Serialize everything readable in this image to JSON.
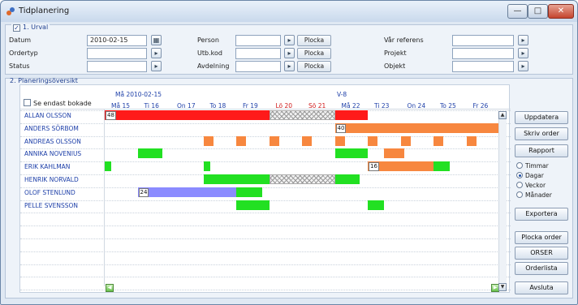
{
  "window": {
    "title": "Tidplanering",
    "controls": {
      "minimize": "—",
      "maximize": "□",
      "close": "✕"
    }
  },
  "filter": {
    "section_title": "1. Urval",
    "checked": true,
    "fields": [
      {
        "label": "Datum",
        "value": "2010-02-15"
      },
      {
        "label": "Ordertyp",
        "value": ""
      },
      {
        "label": "Status",
        "value": ""
      },
      {
        "label": "Person",
        "value": ""
      },
      {
        "label": "Utb.kod",
        "value": ""
      },
      {
        "label": "Avdelning",
        "value": ""
      },
      {
        "label": "Vår referens",
        "value": ""
      },
      {
        "label": "Projekt",
        "value": ""
      },
      {
        "label": "Objekt",
        "value": ""
      }
    ],
    "plocka_label": "Plocka",
    "check_mark": "✓"
  },
  "planning": {
    "section_title": "2. Planeringsöversikt",
    "only_booked_label": "Se endast bokade",
    "week_labels": [
      "Må 2010-02-15",
      "V-8"
    ],
    "days": [
      "Må 15",
      "Ti 16",
      "On 17",
      "To 18",
      "Fr 19",
      "Lö 20",
      "Sö 21",
      "Må 22",
      "Ti 23",
      "On 24",
      "To 25",
      "Fr 26"
    ],
    "weekend_color": "#d11a1a",
    "people": [
      {
        "name": "ALLAN OLSSON",
        "bars": [
          {
            "start": 0,
            "days": 5,
            "color": "#ff1a1a",
            "label": "48"
          },
          {
            "start": 5,
            "days": 2,
            "style": "hatched"
          },
          {
            "start": 7,
            "days": 1,
            "color": "#ff1a1a"
          }
        ]
      },
      {
        "name": "ANDERS SÖRBOM",
        "bars": [
          {
            "start": 7,
            "days": 5,
            "color": "#f7873f",
            "label": "40"
          }
        ]
      },
      {
        "name": "ANDREAS OLSSON",
        "bars": [
          {
            "start": 3,
            "days": 0.3,
            "color": "#f7873f"
          },
          {
            "start": 4,
            "days": 0.3,
            "color": "#f7873f"
          },
          {
            "start": 5,
            "days": 0.3,
            "color": "#f7873f"
          },
          {
            "start": 6,
            "days": 0.3,
            "color": "#f7873f"
          },
          {
            "start": 7,
            "days": 0.3,
            "color": "#f7873f"
          },
          {
            "start": 8,
            "days": 0.3,
            "color": "#f7873f"
          },
          {
            "start": 9,
            "days": 0.3,
            "color": "#f7873f"
          },
          {
            "start": 10,
            "days": 0.3,
            "color": "#f7873f"
          },
          {
            "start": 11,
            "days": 0.3,
            "color": "#f7873f"
          }
        ]
      },
      {
        "name": "ANNIKA NOVENIUS",
        "bars": [
          {
            "start": 1,
            "days": 0.75,
            "color": "#22e022"
          },
          {
            "start": 7,
            "days": 1,
            "color": "#22e022"
          },
          {
            "start": 8.5,
            "days": 0.6,
            "color": "#f7873f"
          }
        ]
      },
      {
        "name": "ERIK KAHLMAN",
        "bars": [
          {
            "start": 0,
            "days": 0.2,
            "color": "#22e022"
          },
          {
            "start": 3,
            "days": 0.2,
            "color": "#22e022"
          },
          {
            "start": 8,
            "days": 2,
            "color": "#f7873f",
            "label": "16"
          },
          {
            "start": 10,
            "days": 0.5,
            "color": "#22e022"
          }
        ]
      },
      {
        "name": "HENRIK NORVALD",
        "bars": [
          {
            "start": 3,
            "days": 2,
            "color": "#22e022"
          },
          {
            "start": 5,
            "days": 2,
            "style": "hatched"
          },
          {
            "start": 7,
            "days": 0.75,
            "color": "#22e022"
          }
        ]
      },
      {
        "name": "OLOF STENLUND",
        "bars": [
          {
            "start": 1,
            "days": 3,
            "color": "#8b8bff",
            "label": "24"
          },
          {
            "start": 4,
            "days": 0.8,
            "color": "#22e022"
          }
        ]
      },
      {
        "name": "PELLE SVENSSON",
        "bars": [
          {
            "start": 4,
            "days": 1,
            "color": "#22e022"
          },
          {
            "start": 8,
            "days": 0.5,
            "color": "#22e022"
          }
        ]
      }
    ]
  },
  "actions": {
    "buttons": [
      "Uppdatera",
      "Skriv order",
      "Rapport"
    ],
    "radio_options": [
      {
        "label": "Timmar",
        "checked": false
      },
      {
        "label": "Dagar",
        "checked": true
      },
      {
        "label": "Veckor",
        "checked": false
      },
      {
        "label": "Månader",
        "checked": false
      }
    ],
    "lower_buttons": [
      "Exportera",
      "Plocka order",
      "ORSER",
      "Orderlista",
      "Avsluta"
    ]
  },
  "scroll": {
    "up": "▲",
    "down": "▼",
    "prev": "◀",
    "next": "▶"
  }
}
